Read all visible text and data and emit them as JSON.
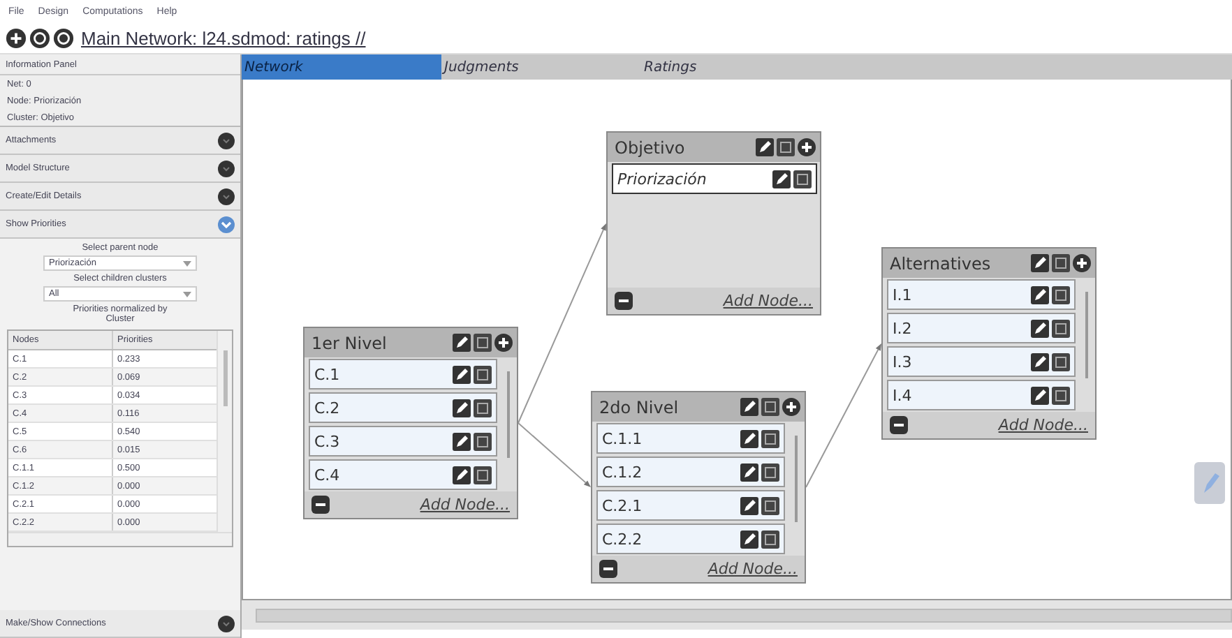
{
  "menu": [
    "File",
    "Design",
    "Computations",
    "Help"
  ],
  "title": "Main Network: l24.sdmod: ratings //",
  "sidebar": {
    "info_panel": {
      "title": "Information Panel",
      "lines": [
        "Net: 0",
        "Node: Priorización",
        "Cluster: Objetivo"
      ]
    },
    "sections": [
      {
        "label": "Attachments",
        "expanded": false
      },
      {
        "label": "Model Structure",
        "expanded": false
      },
      {
        "label": "Create/Edit Details",
        "expanded": false
      },
      {
        "label": "Show Priorities",
        "expanded": true
      }
    ],
    "priorities": {
      "parent_label": "Select parent node",
      "parent_value": "Priorización",
      "children_label": "Select children clusters",
      "children_value": "All",
      "note": "Priorities normalized by Cluster",
      "columns": [
        "Nodes",
        "Priorities"
      ],
      "rows": [
        [
          "C.1",
          "0.233"
        ],
        [
          "C.2",
          "0.069"
        ],
        [
          "C.3",
          "0.034"
        ],
        [
          "C.4",
          "0.116"
        ],
        [
          "C.5",
          "0.540"
        ],
        [
          "C.6",
          "0.015"
        ],
        [
          "C.1.1",
          "0.500"
        ],
        [
          "C.1.2",
          "0.000"
        ],
        [
          "C.2.1",
          "0.000"
        ],
        [
          "C.2.2",
          "0.000"
        ]
      ]
    },
    "footer_section": {
      "label": "Make/Show Connections",
      "expanded": false
    }
  },
  "tabs": [
    {
      "label": "Network",
      "selected": true
    },
    {
      "label": "Judgments",
      "selected": false
    },
    {
      "label": "Ratings",
      "selected": false
    }
  ],
  "clusters": [
    {
      "name": "1er Nivel",
      "scrollable": true,
      "nodes": [
        {
          "name": "C.1",
          "selected": false
        },
        {
          "name": "C.2",
          "selected": false
        },
        {
          "name": "C.3",
          "selected": false
        },
        {
          "name": "C.4",
          "selected": false
        }
      ],
      "add_label": "Add Node..."
    },
    {
      "name": "Objetivo",
      "scrollable": false,
      "nodes": [
        {
          "name": "Priorización",
          "selected": true
        }
      ],
      "add_label": "Add Node..."
    },
    {
      "name": "2do Nivel",
      "scrollable": true,
      "nodes": [
        {
          "name": "C.1.1",
          "selected": false
        },
        {
          "name": "C.1.2",
          "selected": false
        },
        {
          "name": "C.2.1",
          "selected": false
        },
        {
          "name": "C.2.2",
          "selected": false
        }
      ],
      "add_label": "Add Node..."
    },
    {
      "name": "Alternatives",
      "scrollable": true,
      "nodes": [
        {
          "name": "I.1",
          "selected": false
        },
        {
          "name": "I.2",
          "selected": false
        },
        {
          "name": "I.3",
          "selected": false
        },
        {
          "name": "I.4",
          "selected": false
        }
      ],
      "add_label": "Add Node..."
    }
  ]
}
